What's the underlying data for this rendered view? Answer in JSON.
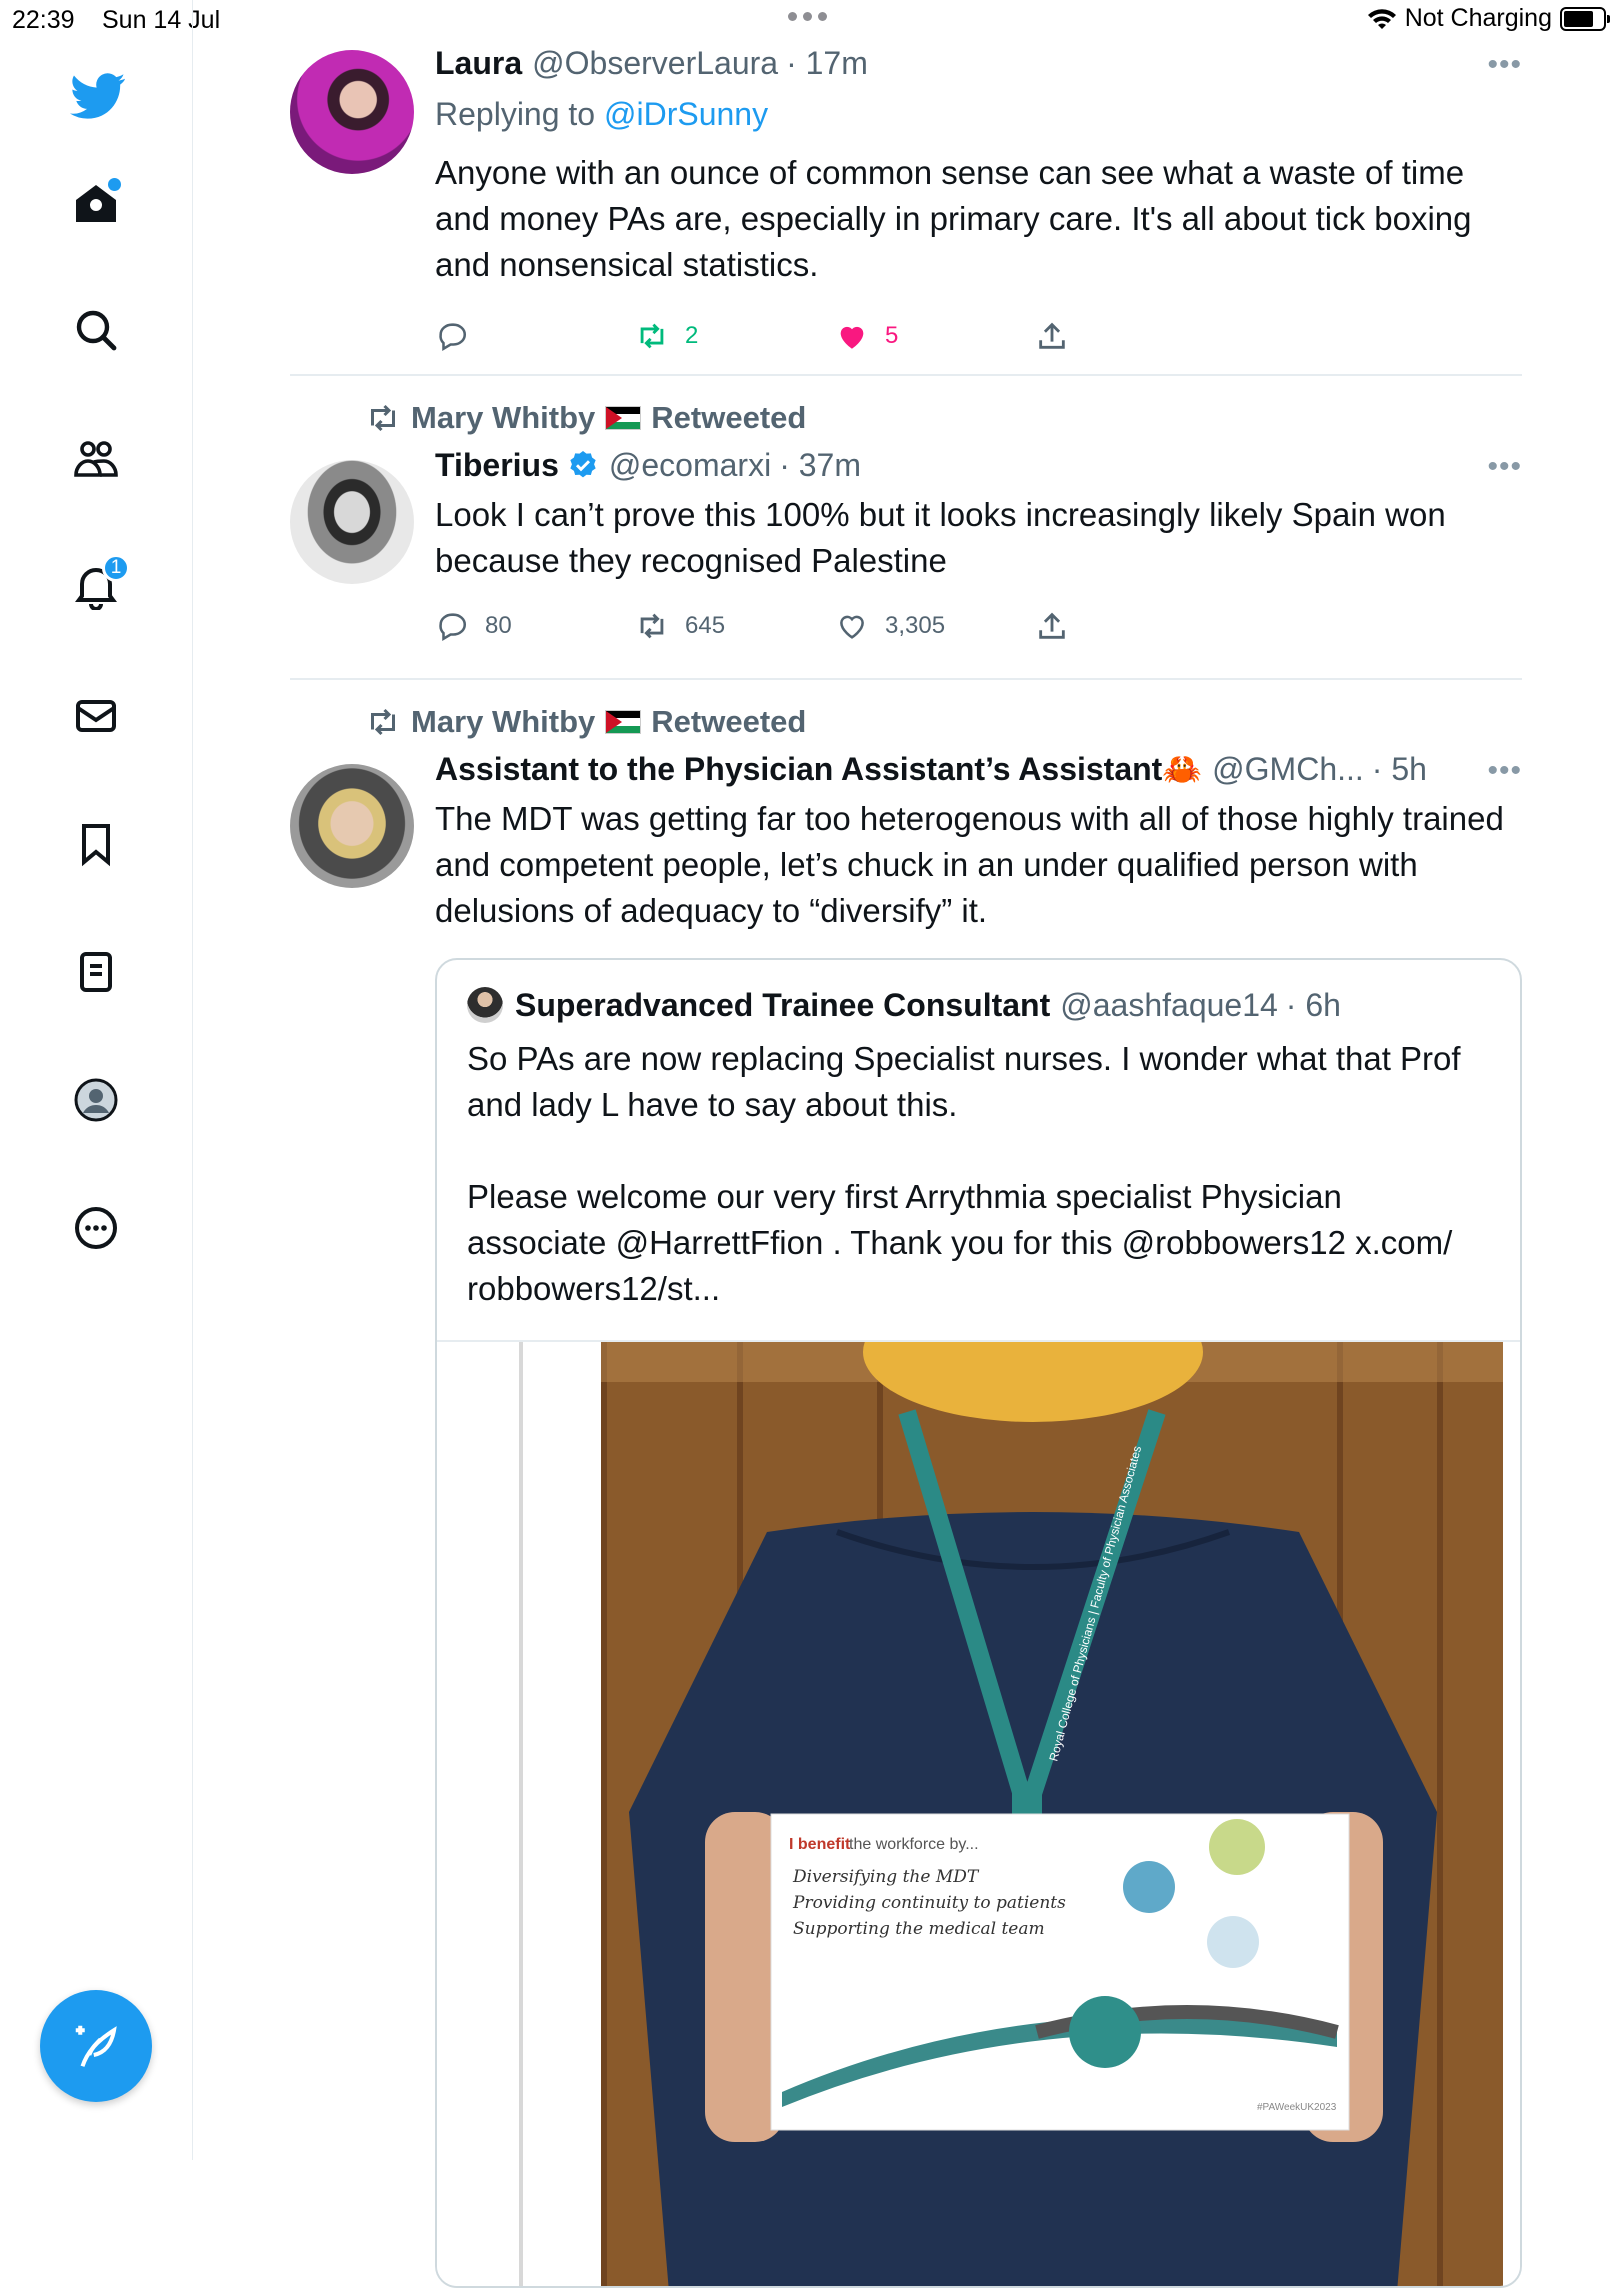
{
  "status_bar": {
    "time": "22:39",
    "date": "Sun 14 Jul",
    "charging": "Not Charging"
  },
  "sidebar": {
    "notifications_badge": "1",
    "items": [
      {
        "icon": "home-icon"
      },
      {
        "icon": "search-icon"
      },
      {
        "icon": "communities-icon"
      },
      {
        "icon": "notifications-icon"
      },
      {
        "icon": "messages-icon"
      },
      {
        "icon": "bookmarks-icon"
      },
      {
        "icon": "lists-icon"
      },
      {
        "icon": "profile-icon"
      },
      {
        "icon": "more-icon"
      }
    ]
  },
  "tweets": [
    {
      "name": "Laura",
      "handle": "@ObserverLaura",
      "time": "· 17m",
      "replying_label": "Replying to",
      "replying_to": "@iDrSunny",
      "text": "Anyone with an ounce of common sense can see what a waste of time and money PAs are, especially in primary care.  It's all about tick boxing and nonsensical statistics.",
      "replies": "",
      "retweets": "2",
      "likes": "5"
    },
    {
      "retweeted_by": "Mary Whitby",
      "retweeted_label": "Retweeted",
      "name": "Tiberius",
      "handle": "@ecomarxi",
      "time": "· 37m",
      "text": "Look I can’t prove this 100% but it looks increasingly likely Spain won because they recognised Palestine",
      "replies": "80",
      "retweets": "645",
      "likes": "3,305"
    },
    {
      "retweeted_by": "Mary Whitby",
      "retweeted_label": "Retweeted",
      "name": "Assistant to the Physician Assistant’s Assistant",
      "name_emoji": "🦀",
      "handle": "@GMCh...",
      "time": "· 5h",
      "text": "The MDT was getting far too heterogenous with all of those highly trained and competent people, let’s chuck in an under qualified person with delusions of adequacy to “diversify” it.",
      "quote": {
        "name": "Superadvanced Trainee Consultant",
        "handle": "@aashfaque14",
        "time": "· 6h",
        "text_1": "So PAs are now replacing Specialist nurses. I wonder what that Prof and lady L have to say about this.",
        "text_2": "Please welcome our very first Arrythmia specialist Physician associate @HarrettFfion . Thank you for this @robbowers12 x.com/ robbowers12/st...",
        "photo": {
          "sign_title_prefix": "I benefit",
          "sign_title_suffix": " the workforce by...",
          "sign_lines": [
            "Diversifying the MDT",
            "Providing continuity to patients",
            "Supporting the medical team"
          ],
          "hashtag": "#PAWeekUK2023",
          "lanyard_text": "Royal College of Physicians | Faculty of Physician Associates"
        }
      }
    }
  ]
}
